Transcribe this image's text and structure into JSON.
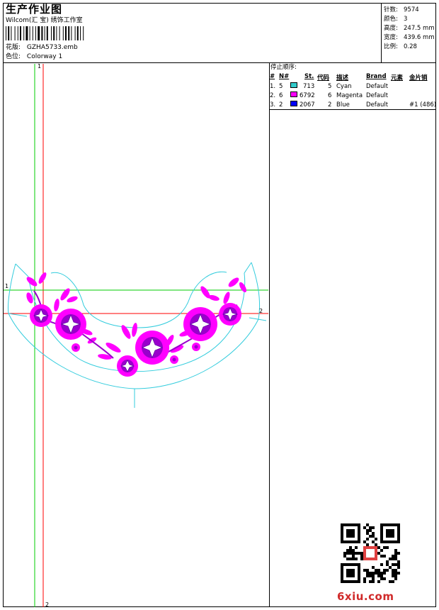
{
  "header": {
    "title": "生产作业图",
    "company": "Wilcom(汇 宝) 绣饰工作室",
    "design_label": "花版:",
    "design_value": "GZHA5733.emb",
    "colorway_label": "色位:",
    "colorway_value": "Colorway 1"
  },
  "stats": [
    {
      "label": "针数:",
      "value": "9574"
    },
    {
      "label": "颜色:",
      "value": "3"
    },
    {
      "label": "高度:",
      "value": "247.5 mm"
    },
    {
      "label": "宽度:",
      "value": "439.6 mm"
    },
    {
      "label": "比例:",
      "value": "0.28"
    }
  ],
  "stop_sequence": {
    "title": "停止顺序:",
    "headers": {
      "num": "#",
      "n": "N#",
      "st": "St.",
      "code": "代码",
      "desc": "描述",
      "brand": "Brand",
      "element": "元素",
      "sequin": "金片销"
    },
    "rows": [
      {
        "num": "1.",
        "n": "5",
        "color": "#33cccc",
        "st": "713",
        "code": "5",
        "desc": "Cyan",
        "brand": "Default",
        "sequin": ""
      },
      {
        "num": "2.",
        "n": "6",
        "color": "#ff00ff",
        "st": "6792",
        "code": "6",
        "desc": "Magenta",
        "brand": "Default",
        "sequin": ""
      },
      {
        "num": "3.",
        "n": "2",
        "color": "#0000ff",
        "st": "2067",
        "code": "2",
        "desc": "Blue",
        "brand": "Default",
        "sequin": "#1 (486)"
      }
    ]
  },
  "guides": {
    "green_label_top": "1",
    "green_label_left": "1",
    "red_label_right": "2",
    "red_label_bottom": "2"
  },
  "colors": {
    "guide_green": "#00cc00",
    "guide_red": "#ff0000",
    "outline_cyan": "#33ccdd",
    "embroidery_magenta": "#ff00ff",
    "embroidery_purple": "#9900cc"
  },
  "watermark": "6xiu.com"
}
